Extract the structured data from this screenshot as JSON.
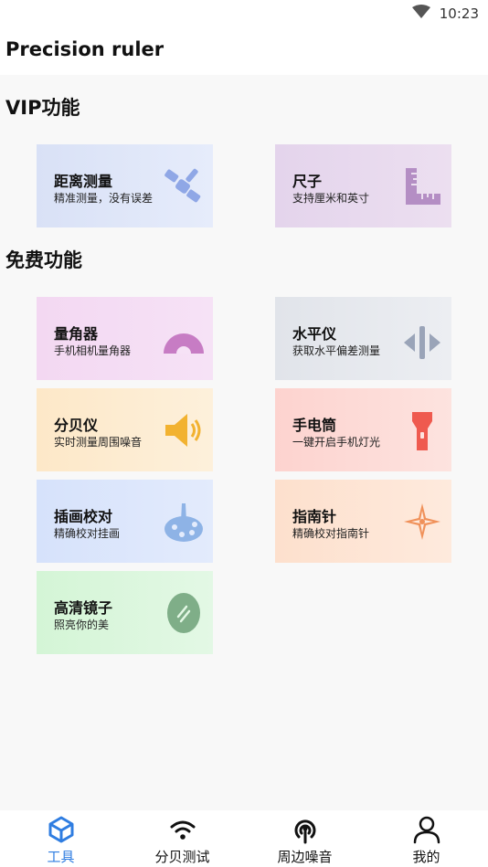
{
  "status_bar": {
    "time": "10:23",
    "icons": [
      "wifi-icon"
    ]
  },
  "header": {
    "title": "Precision ruler"
  },
  "vip_section": {
    "title": "VIP功能",
    "cards": [
      {
        "title": "距离测量",
        "subtitle": "精准测量，没有误差",
        "icon": "satellite-icon",
        "accent": "#8fa7e6"
      },
      {
        "title": "尺子",
        "subtitle": "支持厘米和英寸",
        "icon": "ruler-icon",
        "accent": "#b48ec4"
      }
    ]
  },
  "free_section": {
    "title": "免费功能",
    "cards": [
      {
        "title": "量角器",
        "subtitle": "手机相机量角器",
        "icon": "protractor-icon",
        "accent": "#c77cc4"
      },
      {
        "title": "水平仪",
        "subtitle": "获取水平偏差测量",
        "icon": "level-icon",
        "accent": "#9aa4b8"
      },
      {
        "title": "分贝仪",
        "subtitle": "实时测量周围噪音",
        "icon": "speaker-icon",
        "accent": "#f2b230"
      },
      {
        "title": "手电筒",
        "subtitle": "一键开启手机灯光",
        "icon": "flashlight-icon",
        "accent": "#ef5a4f"
      },
      {
        "title": "插画校对",
        "subtitle": "精确校对挂画",
        "icon": "palette-icon",
        "accent": "#8eb3e6"
      },
      {
        "title": "指南针",
        "subtitle": "精确校对指南针",
        "icon": "compass-icon",
        "accent": "#f0915a"
      },
      {
        "title": "高清镜子",
        "subtitle": "照亮你的美",
        "icon": "mirror-icon",
        "accent": "#7fae88"
      }
    ]
  },
  "bottom_nav": {
    "active_color": "#2f7de1",
    "items": [
      {
        "label": "工具",
        "icon": "cube-icon",
        "active": true
      },
      {
        "label": "分贝测试",
        "icon": "wifi-icon",
        "active": false
      },
      {
        "label": "周边噪音",
        "icon": "broadcast-icon",
        "active": false
      },
      {
        "label": "我的",
        "icon": "user-icon",
        "active": false
      }
    ]
  }
}
